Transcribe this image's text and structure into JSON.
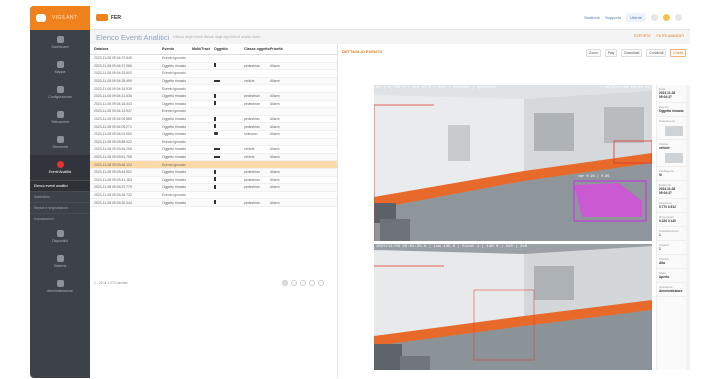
{
  "sidebar": {
    "logo_text": "VIGILANT",
    "items": [
      {
        "label": "Dashboard",
        "icon": "home-icon"
      },
      {
        "label": "Mappa",
        "icon": "map-icon"
      },
      {
        "label": "Configurazione",
        "icon": "gear-icon"
      },
      {
        "label": "Telecamere",
        "icon": "camera-icon"
      },
      {
        "label": "Strumenti",
        "icon": "tools-icon"
      },
      {
        "label": "Eventi Analitici",
        "icon": "alert-icon"
      }
    ],
    "subitems": [
      "Elenco eventi analitici",
      "Statistiche",
      "Report e segnalazioni",
      "Impostazioni"
    ],
    "bottom_items": [
      {
        "label": "Dispositivi",
        "icon": "device-icon"
      },
      {
        "label": "Sistema",
        "icon": "system-icon"
      },
      {
        "label": "Amministrazione",
        "icon": "admin-icon"
      }
    ]
  },
  "topbar": {
    "brand": "FER",
    "links": [
      "Gestione",
      "Supporto"
    ],
    "user": "Utente"
  },
  "title": {
    "main": "Elenco Eventi Analitici",
    "sub": "Elenco degli eventi rilevati dagli algoritmi di analisi video",
    "right_links": [
      "ESPORTA",
      "FILTRI AVANZATI"
    ]
  },
  "table": {
    "headers": [
      "Data/ora",
      "Evento",
      "Multi/Tract",
      "Oggetto",
      "Classe oggetto",
      "Priorità"
    ],
    "rows": [
      {
        "date": "2023-11-08 09:04:37.845",
        "event": "Evento ignorato",
        "multi": "",
        "obj": "",
        "cls": "",
        "pri": "",
        "mark": ""
      },
      {
        "date": "2023-11-08 09:04:37.066",
        "event": "Oggetto rimasto",
        "multi": "",
        "obj": "person",
        "cls": "pedestrian",
        "pri": "Allarm",
        "mark": "tall"
      },
      {
        "date": "2023-11-08 09:04:33.602",
        "event": "Evento ignorato",
        "multi": "",
        "obj": "",
        "cls": "",
        "pri": "",
        "mark": ""
      },
      {
        "date": "2023-11-08 09:04:28.499",
        "event": "Oggetto rimasto",
        "multi": "",
        "obj": "vehicle",
        "cls": "vehicle",
        "pri": "Allarm",
        "mark": "bar"
      },
      {
        "date": "2023-11-08 09:04:24.939",
        "event": "Evento ignorato",
        "multi": "",
        "obj": "",
        "cls": "",
        "pri": "",
        "mark": ""
      },
      {
        "date": "2023-11-08 09:04:21.536",
        "event": "Oggetto rimasto",
        "multi": "",
        "obj": "person",
        "cls": "pedestrian",
        "pri": "Allarm",
        "mark": "tall"
      },
      {
        "date": "2023-11-08 09:04:18.443",
        "event": "Oggetto rimasto",
        "multi": "",
        "obj": "person",
        "cls": "pedestrian",
        "pri": "Allarm",
        "mark": "tall"
      },
      {
        "date": "2023-11-08 09:04:13.947",
        "event": "Evento ignorato",
        "multi": "",
        "obj": "",
        "cls": "",
        "pri": "",
        "mark": ""
      },
      {
        "date": "2023-11-08 09:04:09.589",
        "event": "Oggetto rimasto",
        "multi": "",
        "obj": "person",
        "cls": "pedestrian",
        "pri": "Allarm",
        "mark": "tall"
      },
      {
        "date": "2023-11-08 09:04:05.271",
        "event": "Oggetto rimasto",
        "multi": "",
        "obj": "person",
        "cls": "pedestrian",
        "pri": "Allarm",
        "mark": "tall"
      },
      {
        "date": "2023-11-08 09:04:01.050",
        "event": "Oggetto rimasto",
        "multi": "",
        "obj": "unknown",
        "cls": "unknown",
        "pri": "Allarm",
        "mark": "blob"
      },
      {
        "date": "2023-11-08 09:03:58.022",
        "event": "Evento ignorato",
        "multi": "",
        "obj": "",
        "cls": "",
        "pri": "",
        "mark": ""
      },
      {
        "date": "2023-11-08 09:03:54.266",
        "event": "Oggetto rimasto",
        "multi": "",
        "obj": "vehicle",
        "cls": "vehicle",
        "pri": "Allarm",
        "mark": "bar"
      },
      {
        "date": "2023-11-08 09:03:51.755",
        "event": "Oggetto rimasto",
        "multi": "",
        "obj": "vehicle",
        "cls": "vehicle",
        "pri": "Allarm",
        "mark": "bar"
      },
      {
        "date": "2023-11-08 09:03:48.124",
        "event": "Evento ignorato",
        "multi": "",
        "obj": "",
        "cls": "",
        "pri": "",
        "mark": ""
      },
      {
        "date": "2023-11-08 09:03:44.902",
        "event": "Oggetto rimasto",
        "multi": "",
        "obj": "person",
        "cls": "pedestrian",
        "pri": "Allarm",
        "mark": "tall"
      },
      {
        "date": "2023-11-08 09:03:41.183",
        "event": "Oggetto rimasto",
        "multi": "",
        "obj": "person",
        "cls": "pedestrian",
        "pri": "Allarm",
        "mark": "tall"
      },
      {
        "date": "2023-11-08 09:03:37.779",
        "event": "Oggetto rimasto",
        "multi": "",
        "obj": "person",
        "cls": "pedestrian",
        "pri": "Allarm",
        "mark": "tall"
      },
      {
        "date": "2023-11-08 09:03:34.732",
        "event": "Evento ignorato",
        "multi": "",
        "obj": "",
        "cls": "",
        "pri": "",
        "mark": ""
      },
      {
        "date": "2023-11-08 09:03:30.044",
        "event": "Oggetto rimasto",
        "multi": "",
        "obj": "person",
        "cls": "pedestrian",
        "pri": "Allarm",
        "mark": "tall"
      }
    ],
    "selected_index": 14,
    "footer_text": "1 - 20 di 1.273 risultati",
    "pages": [
      "1",
      "2",
      "3",
      "4",
      "5"
    ]
  },
  "detail": {
    "title": "DETTAGLIO EVENTO",
    "tools": [
      "Zoom",
      "Play",
      "Download",
      "Condividi",
      "Chiudi"
    ],
    "cam1_osd_left": "01 | 4,760 0 | 2x1 17.0 | 0x1 | ParkOut | OpenMode",
    "cam1_osd_right": "2023/11/08 09:04:37",
    "cam2_osd_left": "2023/11/08 09:04:35.6 | Lum 135.0 | Event 1 | 140 0 | 2x0 | 2x0",
    "detection_label": "car 0.94 | 0.95",
    "info": [
      {
        "label": "Data",
        "value": "2023-11-08 09:04:37"
      },
      {
        "label": "Evento",
        "value": "Oggetto rimasto"
      },
      {
        "label": "Telecamera",
        "value": ""
      },
      {
        "label": "Classe",
        "value": "vehicle"
      },
      {
        "label": "Intelligente",
        "value": "Sì"
      },
      {
        "label": "Data/ora",
        "value": "2023-11-08 09:04:37"
      },
      {
        "label": "Posizione",
        "value": "0.770 0.512"
      },
      {
        "label": "Dimensioni",
        "value": "0.226 0.140"
      },
      {
        "label": "Classificazione",
        "value": "1"
      },
      {
        "label": "Oggetti",
        "value": "1"
      },
      {
        "label": "Priorità",
        "value": "Alta"
      },
      {
        "label": "Stato",
        "value": "Aperto"
      },
      {
        "label": "Operatore",
        "value": "Amministratore"
      }
    ]
  },
  "colors": {
    "accent": "#f0821e",
    "sidebar": "#3d4148",
    "selection": "#fbd9a9",
    "alarm": "#e2352b"
  }
}
